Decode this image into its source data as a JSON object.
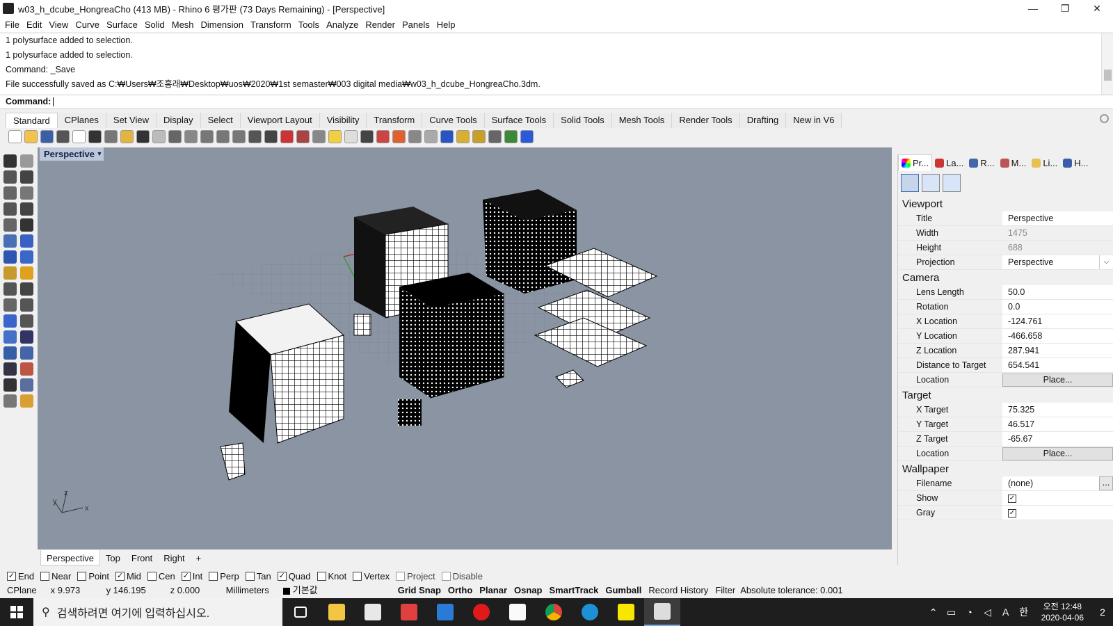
{
  "window": {
    "title": "w03_h_dcube_HongreaCho (413 MB) - Rhino 6 평가판 (73 Days Remaining) - [Perspective]",
    "minimize": "—",
    "restore": "❐",
    "close": "✕"
  },
  "menu": [
    "File",
    "Edit",
    "View",
    "Curve",
    "Surface",
    "Solid",
    "Mesh",
    "Dimension",
    "Transform",
    "Tools",
    "Analyze",
    "Render",
    "Panels",
    "Help"
  ],
  "history": [
    "1 polysurface added to selection.",
    "1 polysurface added to selection.",
    "Command: _Save",
    "File successfully saved as C:₩Users₩조홍래₩Desktop₩uos₩2020₩1st semaster₩003 digital media₩w03_h_dcube_HongreaCho.3dm."
  ],
  "command_label": "Command:",
  "toolbar_tabs": [
    "Standard",
    "CPlanes",
    "Set View",
    "Display",
    "Select",
    "Viewport Layout",
    "Visibility",
    "Transform",
    "Curve Tools",
    "Surface Tools",
    "Solid Tools",
    "Mesh Tools",
    "Render Tools",
    "Drafting",
    "New in V6"
  ],
  "toolbar_icons": [
    "new-file",
    "open-file",
    "save",
    "print",
    "import",
    "cut",
    "copy",
    "paste",
    "undo",
    "pan",
    "rotate",
    "zoom-window",
    "zoom-dynamic",
    "zoom-extents",
    "zoom-selected",
    "named-view",
    "grid",
    "car",
    "carriage",
    "circle-dash",
    "light-bulb",
    "bulb",
    "lock",
    "layer",
    "render-color",
    "sphere-gray",
    "sphere",
    "sphere-blue",
    "wand",
    "gears",
    "snap-tool",
    "globe",
    "help"
  ],
  "left_tool_icons": [
    "select-arrow",
    "point",
    "polyline",
    "curve",
    "circle",
    "circle-center",
    "polygon",
    "rectangle",
    "ellipse",
    "arc",
    "surface",
    "surface-edge",
    "box",
    "sphere-solid",
    "extrude",
    "fillet",
    "boolean",
    "edit",
    "move",
    "rotate-3d",
    "lasso",
    "eyedropper",
    "offset",
    "blend",
    "text",
    "dimension",
    "array",
    "gumball",
    "check",
    "analysis",
    "render-sphere",
    "light"
  ],
  "viewport": {
    "name": "Perspective",
    "dropdown": "▼",
    "axis_x": "x",
    "axis_y": "y",
    "axis_z": "z"
  },
  "viewport_tabs": [
    "Perspective",
    "Top",
    "Front",
    "Right",
    "+"
  ],
  "panel": {
    "tabs": [
      "Pr...",
      "La...",
      "R...",
      "M...",
      "Li...",
      "H..."
    ],
    "sections": [
      {
        "title": "Viewport",
        "rows": [
          {
            "label": "Title",
            "value": "Perspective"
          },
          {
            "label": "Width",
            "value": "1475",
            "gray": true
          },
          {
            "label": "Height",
            "value": "688",
            "gray": true
          },
          {
            "label": "Projection",
            "value": "Perspective",
            "dropdown": true
          }
        ]
      },
      {
        "title": "Camera",
        "rows": [
          {
            "label": "Lens Length",
            "value": "50.0"
          },
          {
            "label": "Rotation",
            "value": "0.0"
          },
          {
            "label": "X Location",
            "value": "-124.761"
          },
          {
            "label": "Y Location",
            "value": "-466.658"
          },
          {
            "label": "Z Location",
            "value": "287.941"
          },
          {
            "label": "Distance to Target",
            "value": "654.541"
          },
          {
            "label": "Location",
            "value": "Place...",
            "button": true
          }
        ]
      },
      {
        "title": "Target",
        "rows": [
          {
            "label": "X Target",
            "value": "75.325"
          },
          {
            "label": "Y Target",
            "value": "46.517"
          },
          {
            "label": "Z Target",
            "value": "-65.67"
          },
          {
            "label": "Location",
            "value": "Place...",
            "button": true
          }
        ]
      },
      {
        "title": "Wallpaper",
        "rows": [
          {
            "label": "Filename",
            "value": "(none)",
            "dots": "..."
          },
          {
            "label": "Show",
            "check": true
          },
          {
            "label": "Gray",
            "check": true
          }
        ]
      }
    ]
  },
  "osnap": [
    {
      "label": "End",
      "on": true
    },
    {
      "label": "Near",
      "on": false
    },
    {
      "label": "Point",
      "on": false
    },
    {
      "label": "Mid",
      "on": true
    },
    {
      "label": "Cen",
      "on": false
    },
    {
      "label": "Int",
      "on": true
    },
    {
      "label": "Perp",
      "on": false
    },
    {
      "label": "Tan",
      "on": false
    },
    {
      "label": "Quad",
      "on": true
    },
    {
      "label": "Knot",
      "on": false
    },
    {
      "label": "Vertex",
      "on": false
    },
    {
      "label": "Project",
      "on": false,
      "dim": true
    },
    {
      "label": "Disable",
      "on": false,
      "dim": true
    }
  ],
  "status": {
    "cplane": "CPlane",
    "x": "x 9.973",
    "y": "y 146.195",
    "z": "z 0.000",
    "units": "Millimeters",
    "layer": "기본값",
    "toggles": [
      "Grid Snap",
      "Ortho",
      "Planar",
      "Osnap",
      "SmartTrack",
      "Gumball"
    ],
    "record": "Record History",
    "filter": "Filter",
    "tolerance": "Absolute tolerance: 0.001"
  },
  "taskbar": {
    "search_placeholder": "검색하려면 여기에 입력하십시오.",
    "time": "오전 12:48",
    "date": "2020-04-06",
    "ime": "A",
    "lang": "한",
    "notification": "2"
  }
}
